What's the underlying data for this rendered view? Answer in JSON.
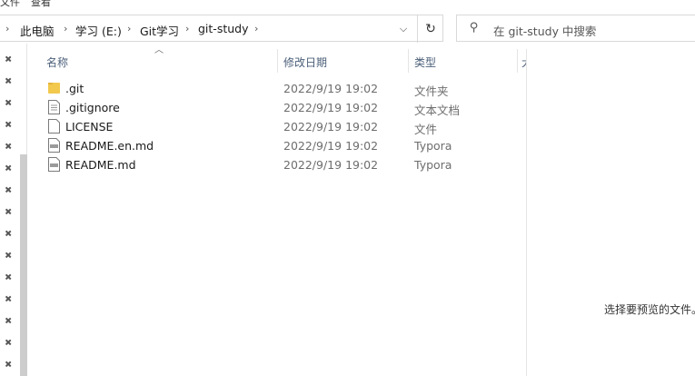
{
  "window": {
    "top_fragments": [
      "文件",
      "查看"
    ]
  },
  "address": {
    "crumbs": [
      "此电脑",
      "学习 (E:)",
      "Git学习",
      "git-study"
    ],
    "dropdown_glyph": "⌵",
    "refresh_glyph": "↻"
  },
  "search": {
    "placeholder": "在 git-study 中搜索"
  },
  "columns": {
    "name": "名称",
    "date": "修改日期",
    "type": "类型",
    "size_partial": "大"
  },
  "files": [
    {
      "name": ".git",
      "date": "2022/9/19 19:02",
      "type": "文件夹",
      "icon": "folder-icon"
    },
    {
      "name": ".gitignore",
      "date": "2022/9/19 19:02",
      "type": "文本文档",
      "icon": "text-file-icon"
    },
    {
      "name": "LICENSE",
      "date": "2022/9/19 19:02",
      "type": "文件",
      "icon": "blank-file-icon"
    },
    {
      "name": "README.en.md",
      "date": "2022/9/19 19:02",
      "type": "Typora",
      "icon": "markdown-file-icon"
    },
    {
      "name": "README.md",
      "date": "2022/9/19 19:02",
      "type": "Typora",
      "icon": "markdown-file-icon"
    }
  ],
  "preview": {
    "message": "选择要预览的文件。"
  },
  "colors": {
    "header_text": "#4c607a",
    "folder": "#f2c94c",
    "meta_text": "#6d6d6d"
  }
}
